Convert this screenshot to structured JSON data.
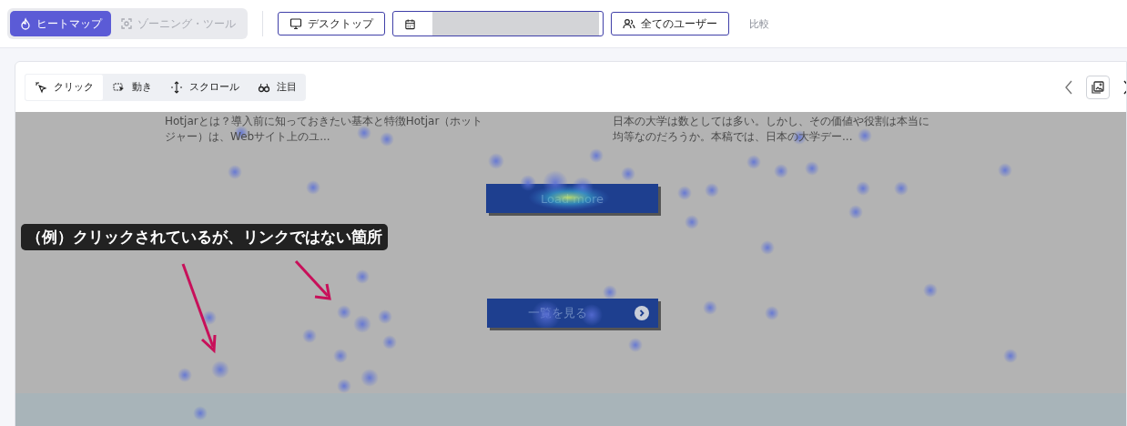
{
  "mode_tabs": [
    {
      "label": "ヒートマップ",
      "selected": true
    },
    {
      "label": "ゾーニング・ツール",
      "selected": false
    }
  ],
  "filters": {
    "device": "デスクトップ",
    "users": "全てのユーザー",
    "compare": "比較"
  },
  "view_tabs": [
    {
      "label": "クリック",
      "selected": true
    },
    {
      "label": "動き",
      "selected": false
    },
    {
      "label": "スクロール",
      "selected": false
    },
    {
      "label": "注目",
      "selected": false
    }
  ],
  "preview": {
    "articles": [
      {
        "lines": [
          "Hotjarとは？導入前に知っておきたい基本と特徴Hotjar（ホット",
          "ジャー）は、Webサイト上のユ..."
        ]
      },
      {
        "lines": [
          "日本の大学は数としては多い。しかし、その価値や役割は本当に",
          "均等なのだろうか。本稿では、日本の大学デー..."
        ]
      }
    ],
    "load_more": "Load more",
    "view_list": "一覧を見る"
  },
  "annotation": "（例）クリックされているが、リンクではない箇所"
}
